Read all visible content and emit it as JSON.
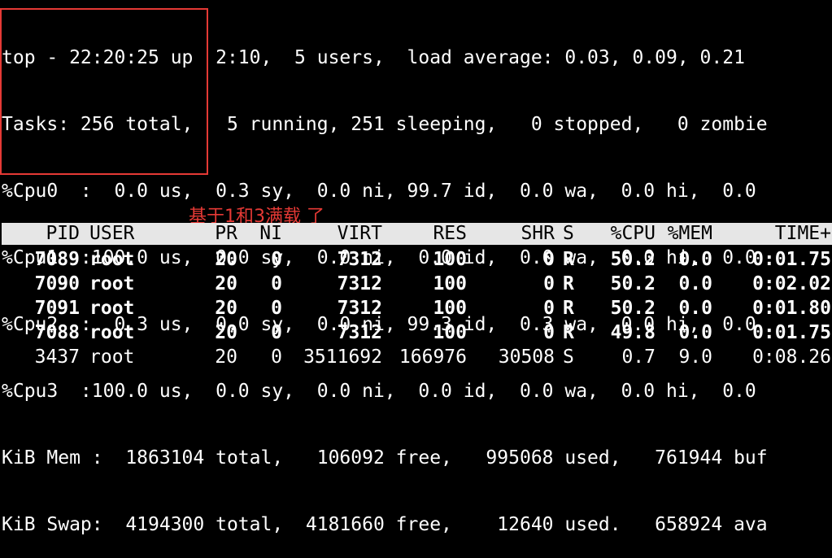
{
  "header_lines": [
    "top - 22:20:25 up  2:10,  5 users,  load average: 0.03, 0.09, 0.21",
    "Tasks: 256 total,   5 running, 251 sleeping,   0 stopped,   0 zombie",
    "%Cpu0  :  0.0 us,  0.3 sy,  0.0 ni, 99.7 id,  0.0 wa,  0.0 hi,  0.0",
    "%Cpu1  :100.0 us,  0.0 sy,  0.0 ni,  0.0 id,  0.0 wa,  0.0 hi,  0.0",
    "%Cpu2  :  0.3 us,  0.0 sy,  0.0 ni, 99.3 id,  0.3 wa,  0.0 hi,  0.0",
    "%Cpu3  :100.0 us,  0.0 sy,  0.0 ni,  0.0 id,  0.0 wa,  0.0 hi,  0.0",
    "KiB Mem :  1863104 total,   106092 free,   995068 used,   761944 buf",
    "KiB Swap:  4194300 total,  4181660 free,    12640 used.   658924 ava"
  ],
  "annotation": {
    "text": "基于1和3满载 了",
    "color": "#e53935"
  },
  "table": {
    "columns": [
      "PID",
      "USER",
      "PR",
      "NI",
      "VIRT",
      "RES",
      "SHR",
      "S",
      "%CPU",
      "%MEM",
      "TIME+"
    ],
    "rows": [
      [
        "7089",
        "root",
        "20",
        "0",
        "7312",
        "100",
        "0",
        "R",
        "50.2",
        "0.0",
        "0:01.75"
      ],
      [
        "7090",
        "root",
        "20",
        "0",
        "7312",
        "100",
        "0",
        "R",
        "50.2",
        "0.0",
        "0:02.02"
      ],
      [
        "7091",
        "root",
        "20",
        "0",
        "7312",
        "100",
        "0",
        "R",
        "50.2",
        "0.0",
        "0:01.80"
      ],
      [
        "7088",
        "root",
        "20",
        "0",
        "7312",
        "100",
        "0",
        "R",
        "49.8",
        "0.0",
        "0:01.75"
      ],
      [
        "3437",
        "root",
        "20",
        "0",
        "3511692",
        "166976",
        "30508",
        "S",
        "0.7",
        "9.0",
        "0:08.26"
      ]
    ]
  }
}
